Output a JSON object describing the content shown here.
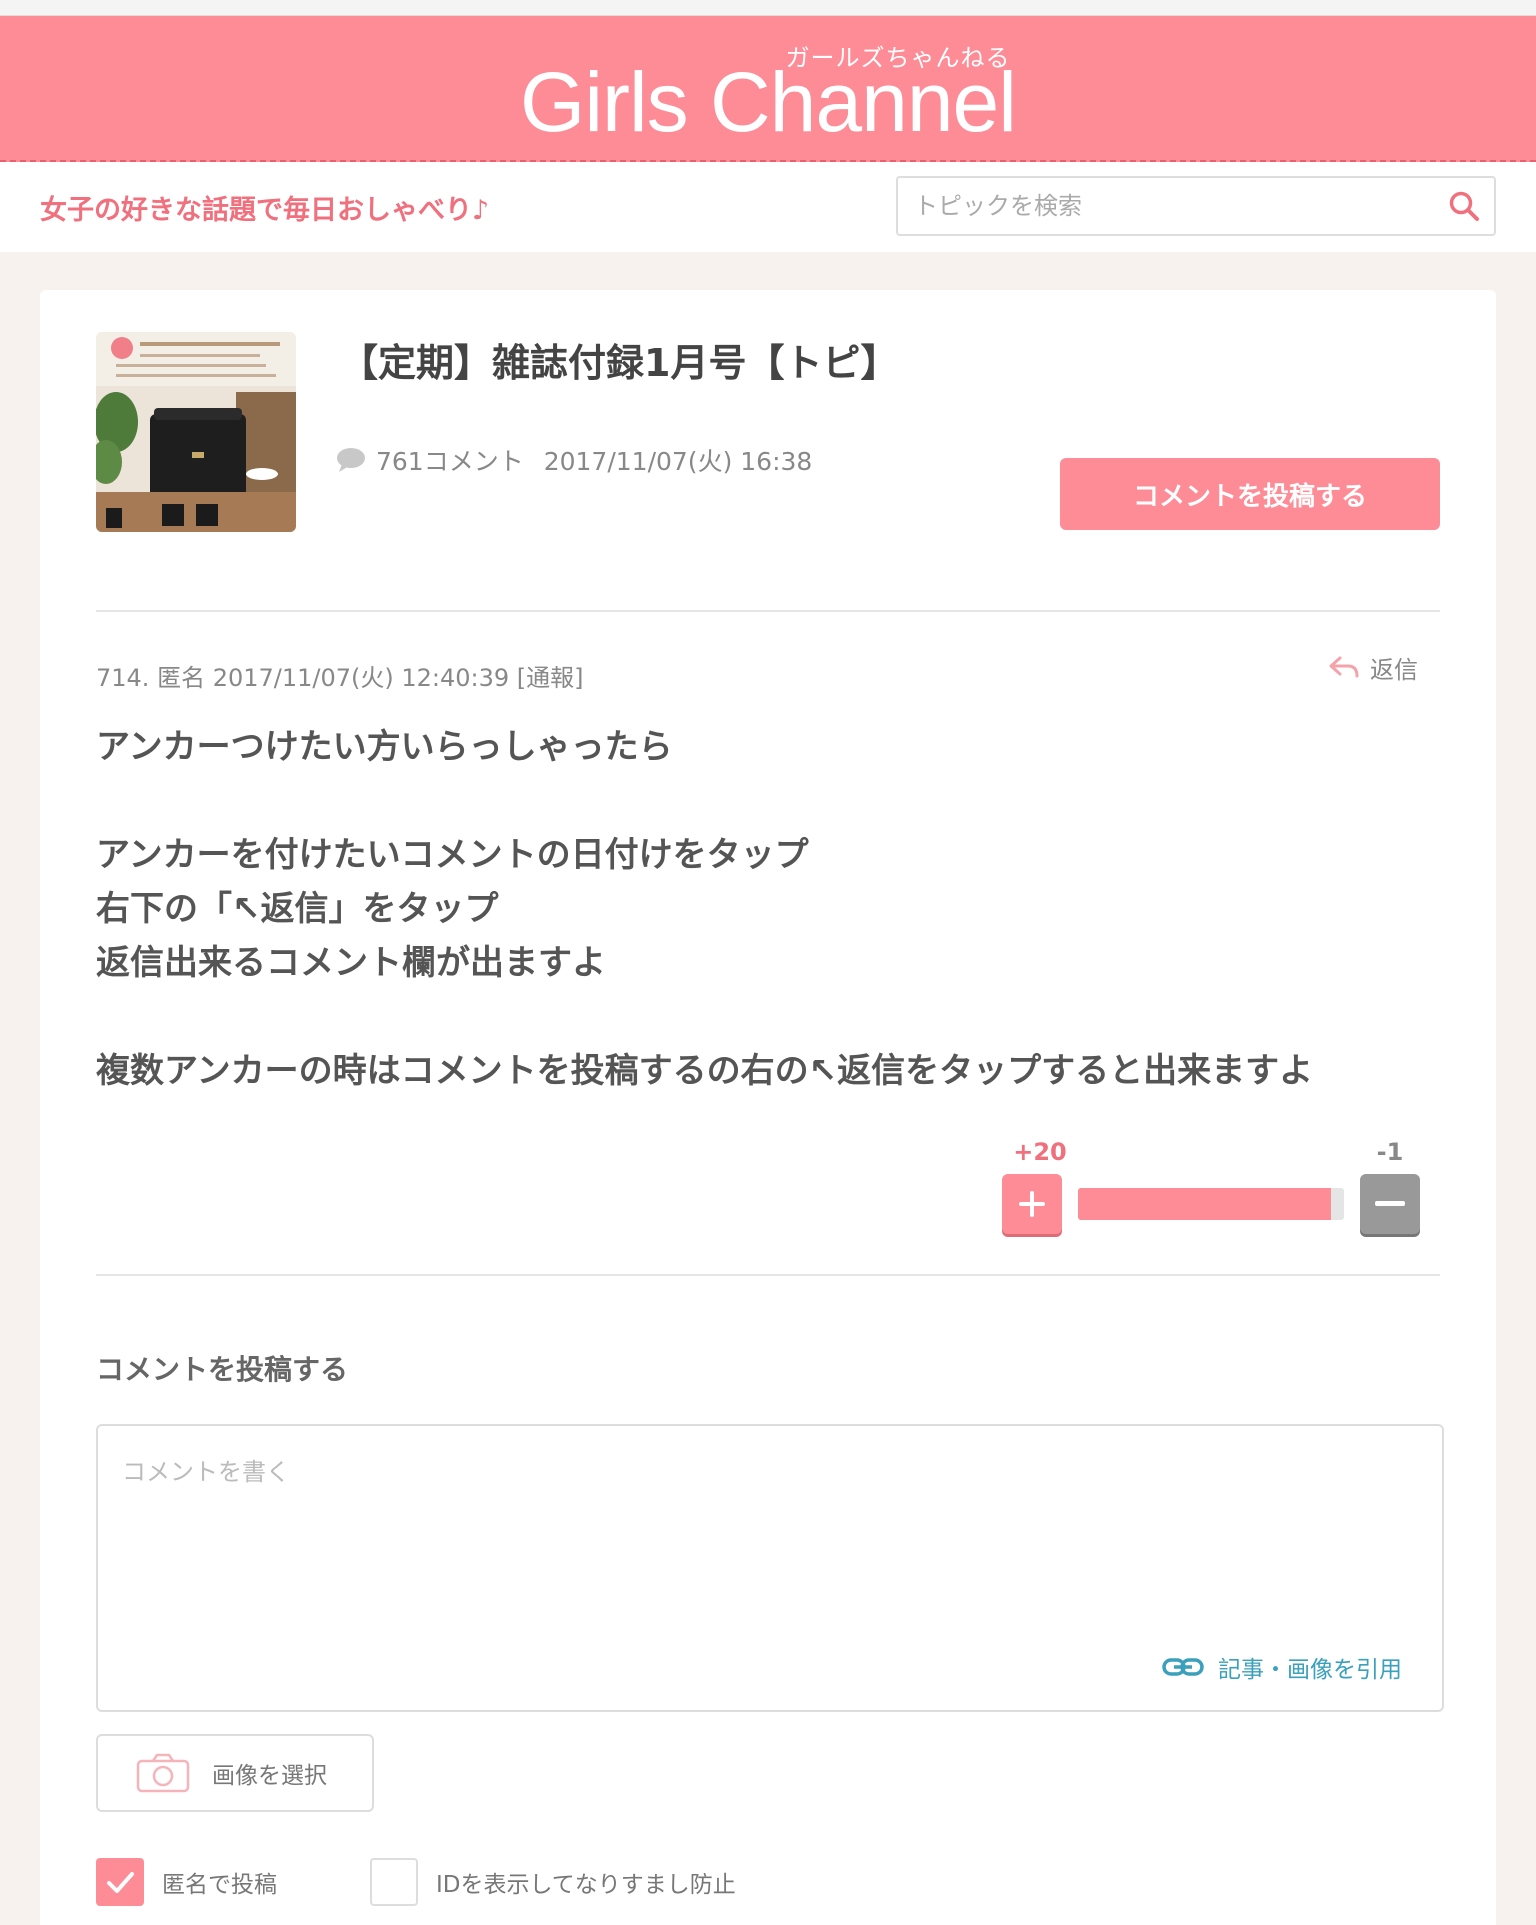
{
  "header": {
    "logo_ruby": "ガールズちゃんねる",
    "logo": "Girls Channel",
    "tagline": "女子の好きな話題で毎日おしゃべり♪",
    "search_placeholder": "トピックを検索"
  },
  "topic": {
    "title": "【定期】雑誌付録1月号【トピ】",
    "comment_count": "761コメント",
    "date": "2017/11/07(火) 16:38",
    "post_button": "コメントを投稿する"
  },
  "comment": {
    "meta": "714. 匿名 2017/11/07(火) 12:40:39 [通報]",
    "reply_label": "返信",
    "lines": [
      "アンカーつけたい方いらっしゃったら",
      "",
      "アンカーを付けたいコメントの日付けをタップ",
      "右下の「↖返信」をタップ",
      "返信出来るコメント欄が出ますよ",
      "",
      "複数アンカーの時はコメントを投稿するの右の↖返信をタップすると出来ますよ"
    ],
    "plus_count": "+20",
    "minus_count": "-1",
    "plus_ratio": 0.95
  },
  "form": {
    "title": "コメントを投稿する",
    "placeholder": "コメントを書く",
    "quote_label": "記事・画像を引用",
    "image_button": "画像を選択",
    "anonymous_label": "匿名で投稿",
    "anonymous_checked": true,
    "show_id_label": "IDを表示してなりすまし防止",
    "show_id_checked": false
  },
  "colors": {
    "brand_pink": "#fd8c96",
    "link_blue": "#3aa0bb"
  }
}
